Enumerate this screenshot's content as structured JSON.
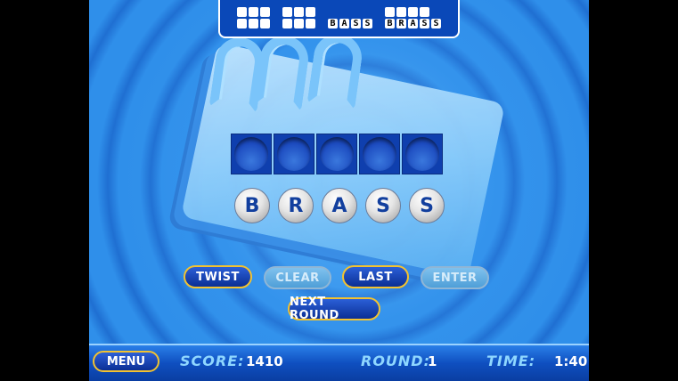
{
  "tracker": {
    "words": [
      {
        "rows": [
          [
            "",
            "",
            ""
          ],
          [
            "",
            "",
            ""
          ]
        ]
      },
      {
        "rows": [
          [
            "",
            "",
            ""
          ],
          [
            "",
            "",
            ""
          ]
        ]
      },
      {
        "rows": [
          [
            "",
            "",
            ""
          ],
          [
            "B",
            "A",
            "S",
            "S"
          ]
        ]
      },
      {
        "rows": [
          [
            "",
            "",
            "",
            ""
          ],
          [
            "B",
            "R",
            "A",
            "S",
            "S"
          ]
        ]
      }
    ]
  },
  "letters": [
    "B",
    "R",
    "A",
    "S",
    "S"
  ],
  "slots_count": 5,
  "buttons": {
    "twist": "TWIST",
    "clear": "CLEAR",
    "last": "LAST",
    "enter": "ENTER",
    "next_round": "NEXT ROUND",
    "menu": "MENU"
  },
  "status": {
    "score_label": "SCORE:",
    "score_value": "1410",
    "round_label": "ROUND:",
    "round_value": "1",
    "time_label": "TIME:",
    "time_value": "1:40"
  },
  "colors": {
    "accent_border": "#f2c230",
    "letter_color": "#123f9e",
    "status_label": "#8fd7ff"
  }
}
